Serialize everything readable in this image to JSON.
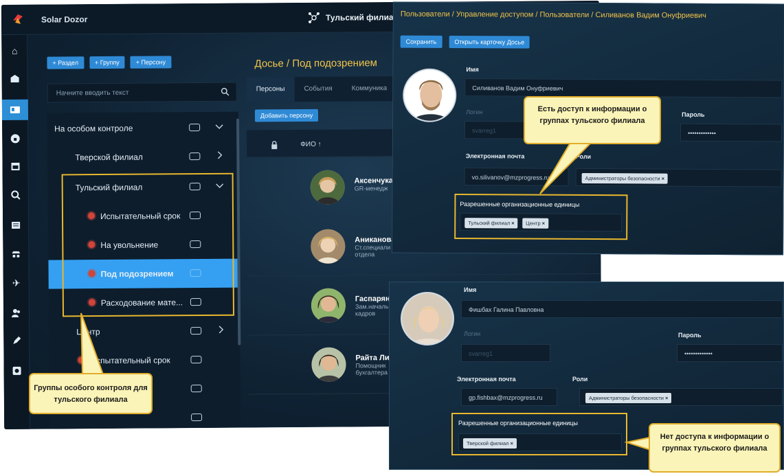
{
  "app": {
    "title": "Solar Dozor",
    "branch": "Тульский филиал",
    "add_buttons": [
      "+ Раздел",
      "+ Группу",
      "+ Персону"
    ],
    "search_placeholder": "Начните вводить текст",
    "rail_icons": [
      "home-icon",
      "building-icon",
      "id-card-icon",
      "lock-round-icon",
      "calendar-icon",
      "search-icon",
      "list-icon",
      "spy-icon",
      "plane-icon",
      "users-icon",
      "pen-icon",
      "gear-icon"
    ],
    "tree": [
      {
        "label": "На особом контроле",
        "level": 0,
        "expanded": true
      },
      {
        "label": "Тверской филиал",
        "level": 1,
        "expanded": false
      },
      {
        "label": "Тульский филиал",
        "level": 1,
        "expanded": true
      },
      {
        "label": "Испытательный срок",
        "level": 2
      },
      {
        "label": "На увольнение",
        "level": 2
      },
      {
        "label": "Под подозрением",
        "level": 2,
        "selected": true
      },
      {
        "label": "Расходование мате...",
        "level": 2
      },
      {
        "label": "Центр",
        "level": 1,
        "expanded": false
      },
      {
        "label": "Испытательный срок",
        "level": 2
      }
    ],
    "dossier_title": "Досье / Под подозрением",
    "tabs": [
      "Персоны",
      "События",
      "Коммуника"
    ],
    "add_person": "Добавить персону",
    "column_fio": "ФИО ↑",
    "persons": [
      {
        "name": "Аксенчука",
        "role": "GR-менедж"
      },
      {
        "name": "Аниканова",
        "role": "Ст.специали отдела"
      },
      {
        "name": "Гаспарян",
        "role": "Зам.начальн кадров"
      },
      {
        "name": "Райта Лиа",
        "role": "Помощник бухгалтера"
      }
    ]
  },
  "card1": {
    "breadcrumb": "Пользователи / Управление доступом / Пользователи / Силиванов Вадим Онуфриевич",
    "save": "Сохранить",
    "open_card": "Открыть карточку Досье",
    "name_label": "Имя",
    "name_value": "Силиванов Вадим Онуфриевич",
    "login_label": "Логин",
    "login_value": "svarreg1",
    "password_label": "Пароль",
    "password_value": "•••••••••••••",
    "email_label": "Электронная почта",
    "email_value": "vo.silivanov@mzprogress.ru",
    "roles_label": "Роли",
    "role_chip": "Администраторы безопасности",
    "org_label": "Разрешенные организационные единицы",
    "org_chips": [
      "Тульский филиал",
      "Центр"
    ]
  },
  "card2": {
    "name_label": "Имя",
    "name_value": "Фишбах Галина Павловна",
    "login_label": "Логин",
    "login_value": "svarreg1",
    "password_label": "Пароль",
    "password_value": "•••••••••••••",
    "email_label": "Электронная почта",
    "email_value": "gp.fishbax@mzprogress.ru",
    "roles_label": "Роли",
    "role_chip": "Администраторы безопасности",
    "org_label": "Разрешенные организационные единицы",
    "org_chips": [
      "Тверской филиал"
    ]
  },
  "callouts": {
    "access": "Есть доступ к информации о группах тульского филиала",
    "groups": "Группы особого контроля для тульского филиала",
    "no_access": "Нет доступа к информации о группах тульского филиала"
  },
  "colors": {
    "accent": "#2f8ad6",
    "selected": "#35a0f2",
    "gold": "#e9b82e",
    "crumb": "#f0c34a",
    "callout_bg": "#fbf4b8"
  }
}
